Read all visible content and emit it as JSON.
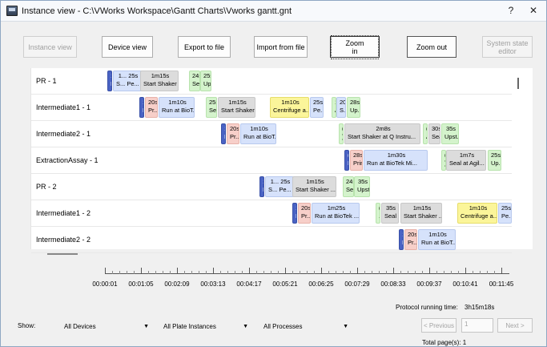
{
  "window": {
    "title": "Instance view - C:\\VWorks Workspace\\Gantt Charts\\Vworks gantt.gnt",
    "help": "?",
    "close": "✕"
  },
  "toolbar": {
    "instance_view": "Instance view",
    "device_view": "Device view",
    "export": "Export to file",
    "import": "Import from file",
    "zoom_in": "Zoom in",
    "zoom_out": "Zoom out",
    "system_state": "System state editor"
  },
  "gantt": {
    "rows": [
      {
        "label": "PR - 1",
        "tasks": [
          {
            "dur": "1...",
            "name": "D...",
            "color": "t-blue-dark"
          },
          {
            "dur": "1... 25s",
            "name": "S... Pe...",
            "color": "t-blue"
          },
          {
            "dur": "1m15s",
            "name": "Start Shaker ...",
            "color": "t-gray"
          },
          {
            "dur": "24s",
            "name": "Se...",
            "color": "t-green"
          },
          {
            "dur": "25s",
            "name": "Up...",
            "color": "t-green"
          }
        ]
      },
      {
        "label": "Intermediate1 - 1",
        "tasks": [
          {
            "dur": "1...",
            "name": "D...",
            "color": "t-blue-dark"
          },
          {
            "dur": "20s",
            "name": "Pr...",
            "color": "t-pink"
          },
          {
            "dur": "1m10s",
            "name": "Run at BioT...",
            "color": "t-blue"
          },
          {
            "dur": "25s",
            "name": "Se...",
            "color": "t-green"
          },
          {
            "dur": "1m15s",
            "name": "Start Shaker ...",
            "color": "t-gray"
          },
          {
            "dur": "1m10s",
            "name": "Centrifuge a...",
            "color": "t-yellow"
          },
          {
            "dur": "25s",
            "name": "Pe...",
            "color": "t-blue"
          },
          {
            "dur": "1...",
            "name": "A...",
            "color": "t-green"
          },
          {
            "dur": "20s",
            "name": "S...",
            "color": "t-blue"
          },
          {
            "dur": "28s",
            "name": "Up...",
            "color": "t-green"
          }
        ]
      },
      {
        "label": "Intermediate2 - 1",
        "tasks": [
          {
            "dur": "1...",
            "name": "D...",
            "color": "t-blue-dark"
          },
          {
            "dur": "20s",
            "name": "Pr...",
            "color": "t-pink"
          },
          {
            "dur": "1m10s",
            "name": "Run at BioT...",
            "color": "t-blue"
          },
          {
            "dur": "(...",
            "name": ")...",
            "color": "t-green"
          },
          {
            "dur": "2m8s",
            "name": "Start Shaker at Q Instru...",
            "color": "t-gray"
          },
          {
            "dur": "(...",
            "name": "A...",
            "color": "t-green"
          },
          {
            "dur": "30s",
            "name": "Sea...",
            "color": "t-gray"
          },
          {
            "dur": "35s",
            "name": "Upst...",
            "color": "t-green"
          }
        ]
      },
      {
        "label": "ExtractionAssay - 1",
        "tasks": [
          {
            "dur": "(...",
            "name": "D...",
            "color": "t-blue-dark"
          },
          {
            "dur": "28s",
            "name": "Prin...",
            "color": "t-pink"
          },
          {
            "dur": "1m30s",
            "name": "Run at BioTek Mi...",
            "color": "t-blue"
          },
          {
            "dur": "(...",
            "name": ")...",
            "color": "t-green"
          },
          {
            "dur": "1m7s",
            "name": "Seal at Agil...",
            "color": "t-gray"
          },
          {
            "dur": "25s",
            "name": "Up...",
            "color": "t-green"
          }
        ]
      },
      {
        "label": "PR - 2",
        "tasks": [
          {
            "dur": "1...",
            "name": "D...",
            "color": "t-blue-dark"
          },
          {
            "dur": "1... 25s",
            "name": "S... Pe...",
            "color": "t-blue"
          },
          {
            "dur": "1m15s",
            "name": "Start Shaker ...",
            "color": "t-gray"
          },
          {
            "dur": "24s",
            "name": "Se...",
            "color": "t-green"
          },
          {
            "dur": "35s",
            "name": "Upst...",
            "color": "t-green"
          }
        ]
      },
      {
        "label": "Intermediate1 - 2",
        "tasks": [
          {
            "dur": "1...",
            "name": "D...",
            "color": "t-blue-dark"
          },
          {
            "dur": "20s",
            "name": "Pr...",
            "color": "t-pink"
          },
          {
            "dur": "1m25s",
            "name": "Run at BioTek ...",
            "color": "t-blue"
          },
          {
            "dur": "(...",
            "name": "...",
            "color": "t-green"
          },
          {
            "dur": "35s",
            "name": "Seal ...",
            "color": "t-gray"
          },
          {
            "dur": "1m15s",
            "name": "Start Shaker ...",
            "color": "t-gray"
          },
          {
            "dur": "1m10s",
            "name": "Centrifuge a...",
            "color": "t-yellow"
          },
          {
            "dur": "25s",
            "name": "Pe...",
            "color": "t-blue"
          }
        ]
      },
      {
        "label": "Intermediate2 - 2",
        "tasks": [
          {
            "dur": "1...",
            "name": "D...",
            "color": "t-blue-dark"
          },
          {
            "dur": "20s",
            "name": "Pr...",
            "color": "t-pink"
          },
          {
            "dur": "1m10s",
            "name": "Run at BioT...",
            "color": "t-blue"
          }
        ]
      }
    ]
  },
  "timeline": {
    "ticks": [
      "00:00:01",
      "00:01:05",
      "00:02:09",
      "00:03:13",
      "00:04:17",
      "00:05:21",
      "00:06:25",
      "00:07:29",
      "00:08:33",
      "00:09:37",
      "00:10:41",
      "00:11:45"
    ]
  },
  "protocol": {
    "running_label": "Protocol running time:",
    "running_value": "3h15m18s"
  },
  "filters": {
    "show_label": "Show:",
    "devices": "All Devices",
    "plates": "All Plate Instances",
    "processes": "All Processes"
  },
  "pager": {
    "previous": "< Previous",
    "page": "1",
    "next": "Next >",
    "total": "Total page(s): 1"
  }
}
